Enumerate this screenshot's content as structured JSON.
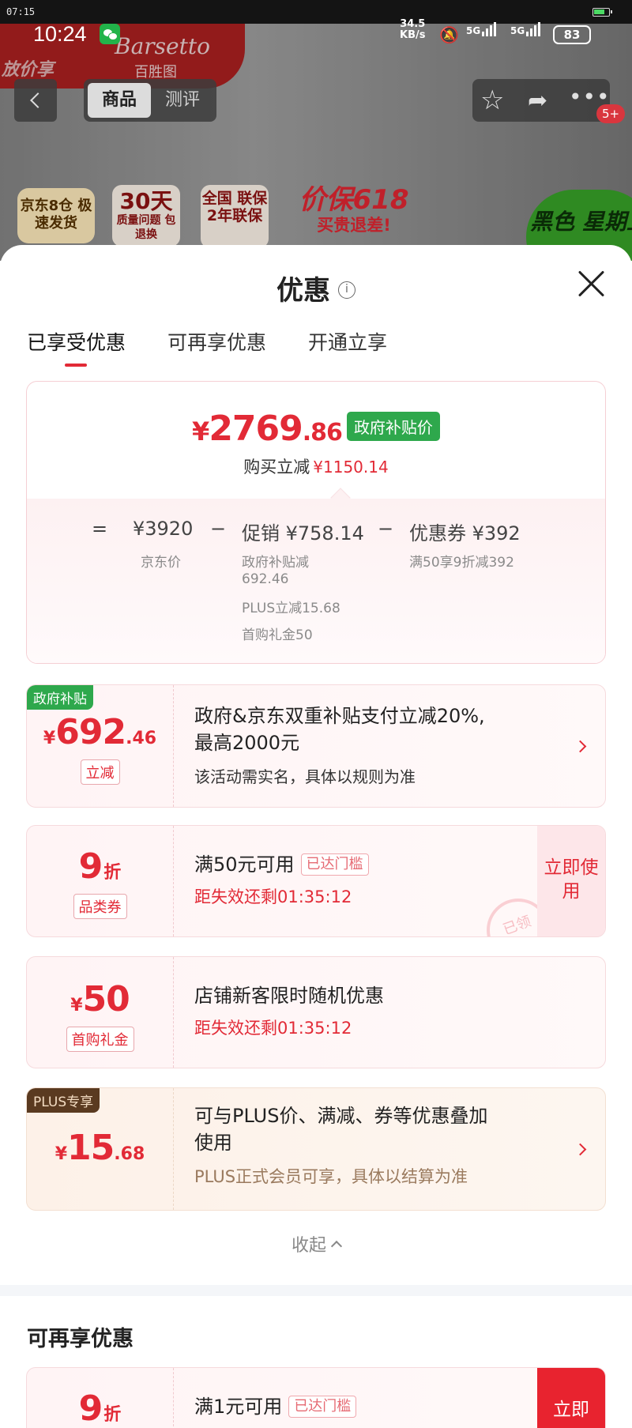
{
  "os_status": {
    "time": "07:15"
  },
  "phone_status": {
    "clock": "10:24",
    "net_speed_value": "34.5",
    "net_speed_unit": "KB/s",
    "sim1": "5G",
    "sim2": "5G",
    "battery": "83"
  },
  "background": {
    "brand_left": "放价享",
    "brand_name": "Barsetto",
    "brand_sub": "百胜图",
    "tabs": [
      "商品",
      "测评"
    ],
    "message_badge": "5+",
    "promos": {
      "p1": "京东8仓 极速发货",
      "p2_big": "30天",
      "p2_small": "质量问题 包退换",
      "p3": "全国 联保 2年联保",
      "p4_big": "价保618",
      "p4_small": "买贵退差!",
      "p5": "黑色 星期五"
    }
  },
  "sheet": {
    "title": "优惠",
    "tabs": [
      "已享受优惠",
      "可再享优惠",
      "开通立享"
    ],
    "summary": {
      "price_yen": "¥",
      "price_int": "2769",
      "price_dec": ".86",
      "price_tag": "政府补贴价",
      "reduce_label": "购买立减",
      "reduce_amount": "¥1150.14",
      "eq": "=",
      "base_price": "¥3920",
      "base_label": "京东价",
      "minus1": "−",
      "promo_line": "促销 ¥758.14",
      "promo_detail_1a": "政府补贴减",
      "promo_detail_1b": "692.46",
      "promo_detail_2": "PLUS立减15.68",
      "promo_detail_3": "首购礼金50",
      "minus2": "−",
      "coupon_line": "优惠券 ¥392",
      "coupon_detail": "满50享9折减392"
    },
    "deals": [
      {
        "corner": "政府补贴",
        "sym": "¥",
        "int": "692",
        "dec": ".46",
        "tag": "立减",
        "title_1": "政府&京东双重补贴支付立减20%,",
        "title_2": "最高2000元",
        "note": "该活动需实名，具体以规则为准"
      },
      {
        "int": "9",
        "unit": "折",
        "tag": "品类券",
        "title": "满50元可用",
        "badge": "已达门槛",
        "note": "距失效还剩01:35:12",
        "action": "立即使用"
      },
      {
        "sym": "¥",
        "int": "50",
        "tag": "首购礼金",
        "title": "店铺新客限时随机优惠",
        "note": "距失效还剩01:35:12"
      },
      {
        "corner": "PLUS专享",
        "sym": "¥",
        "int": "15",
        "dec": ".68",
        "title_1": "可与PLUS价、满减、券等优惠叠加",
        "title_2": "使用",
        "note": "PLUS正式会员可享，具体以结算为准"
      }
    ],
    "collapse_label": "收起",
    "more_section_title": "可再享优惠",
    "more_deal": {
      "int": "9",
      "unit": "折",
      "title": "满1元可用",
      "badge": "已达门槛",
      "action": "立即"
    }
  }
}
